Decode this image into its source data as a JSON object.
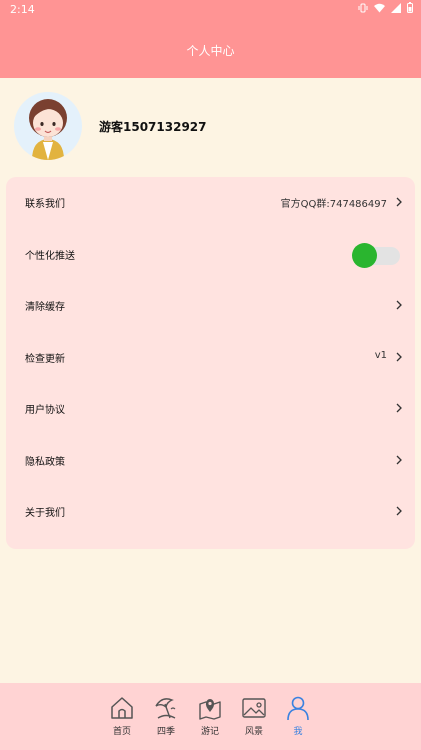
{
  "status_bar": {
    "time": "2:14"
  },
  "header": {
    "title": "个人中心"
  },
  "profile": {
    "username": "游客1507132927"
  },
  "menu": [
    {
      "label": "联系我们",
      "value": "官方QQ群:747486497"
    },
    {
      "label": "个性化推送",
      "toggle_on": true
    },
    {
      "label": "清除缓存"
    },
    {
      "label": "检查更新",
      "value": "v1"
    },
    {
      "label": "用户协议"
    },
    {
      "label": "隐私政策"
    },
    {
      "label": "关于我们"
    }
  ],
  "tabs": [
    {
      "label": "首页",
      "icon": "home-icon"
    },
    {
      "label": "四季",
      "icon": "beach-umbrella-icon"
    },
    {
      "label": "游记",
      "icon": "map-pin-icon"
    },
    {
      "label": "风景",
      "icon": "image-icon"
    },
    {
      "label": "我",
      "icon": "user-icon",
      "active": true
    }
  ],
  "colors": {
    "header": "#ff9494",
    "background": "#fdf4e3",
    "card": "#ffe3e0",
    "tabbar": "#ffd3d3",
    "toggle_on": "#2ab52f",
    "active_tab": "#3a82e0"
  }
}
